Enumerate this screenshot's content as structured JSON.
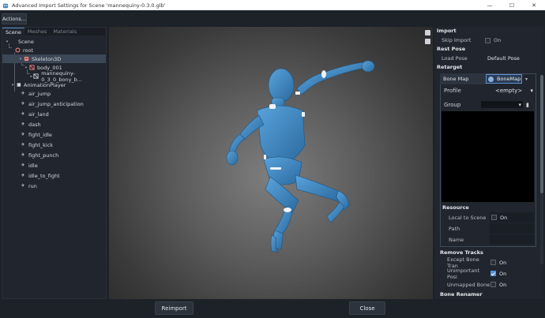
{
  "window": {
    "title": "Advanced Import Settings for Scene 'mannequiny-0.3.0.glb'",
    "controls": {
      "minimize": "—",
      "maximize": "☐",
      "close": "✕"
    }
  },
  "toolbar": {
    "actions_label": "Actions..."
  },
  "left_panel": {
    "tabs": [
      {
        "label": "Scene",
        "active": true
      },
      {
        "label": "Meshes",
        "active": false
      },
      {
        "label": "Materials",
        "active": false
      }
    ],
    "tree": [
      {
        "label": "Scene",
        "icon": "scene-icon",
        "depth": 0,
        "arrow": "▾"
      },
      {
        "label": "root",
        "icon": "node3d-icon",
        "depth": 1,
        "arrow": ""
      },
      {
        "label": "Skeleton3D",
        "icon": "skeleton-icon",
        "depth": 2,
        "arrow": "▾",
        "selected": true
      },
      {
        "label": "body_001",
        "icon": "mesh-icon",
        "depth": 3,
        "arrow": "▾"
      },
      {
        "label": "mannequiny-0_3_0_bony_b...",
        "icon": "mesh-icon",
        "depth": 4,
        "arrow": "▸"
      },
      {
        "label": "AnimationPlayer",
        "icon": "animation-player-icon",
        "depth": 1,
        "arrow": "▾"
      },
      {
        "label": "air_jump",
        "icon": "animation-icon",
        "depth": 2
      },
      {
        "label": "air_jump_anticipation",
        "icon": "animation-icon",
        "depth": 2
      },
      {
        "label": "air_land",
        "icon": "animation-icon",
        "depth": 2
      },
      {
        "label": "dash",
        "icon": "animation-icon",
        "depth": 2
      },
      {
        "label": "fight_idle",
        "icon": "animation-icon",
        "depth": 2
      },
      {
        "label": "fight_kick",
        "icon": "animation-icon",
        "depth": 2
      },
      {
        "label": "fight_punch",
        "icon": "animation-icon",
        "depth": 2
      },
      {
        "label": "idle",
        "icon": "animation-icon",
        "depth": 2
      },
      {
        "label": "idle_to_fight",
        "icon": "animation-icon",
        "depth": 2
      },
      {
        "label": "run",
        "icon": "animation-icon",
        "depth": 2
      }
    ]
  },
  "inspector": {
    "import": {
      "header": "Import",
      "skip_import_label": "Skip Import",
      "skip_import_value": "On"
    },
    "rest_pose": {
      "header": "Rest Pose",
      "load_pose_label": "Load Pose",
      "load_pose_value": "Default Pose"
    },
    "retarget": {
      "header": "Retarget",
      "bone_map_label": "Bone Map",
      "bone_map_value": "BoneMap",
      "profile_label": "Profile",
      "profile_value": "<empty>",
      "group_label": "Group",
      "group_value": ""
    },
    "resource": {
      "header": "Resource",
      "local_to_scene_label": "Local to Scene",
      "local_to_scene_value": "On",
      "path_label": "Path",
      "path_value": "",
      "name_label": "Name",
      "name_value": ""
    },
    "remove_tracks": {
      "header": "Remove Tracks",
      "except_bone_label": "Except Bone Tran",
      "except_bone_value": "On",
      "unimportant_label": "Unimportant Posi",
      "unimportant_value": "On",
      "unmapped_label": "Unmapped Bone",
      "unmapped_value": "On"
    },
    "bone_renamer": {
      "header": "Bone Renamer"
    }
  },
  "footer": {
    "reimport_label": "Reimport",
    "close_label": "Close"
  },
  "colors": {
    "accent": "#4f8fdc",
    "mannequin": "#3a7fb8",
    "background": "#1d2229"
  }
}
